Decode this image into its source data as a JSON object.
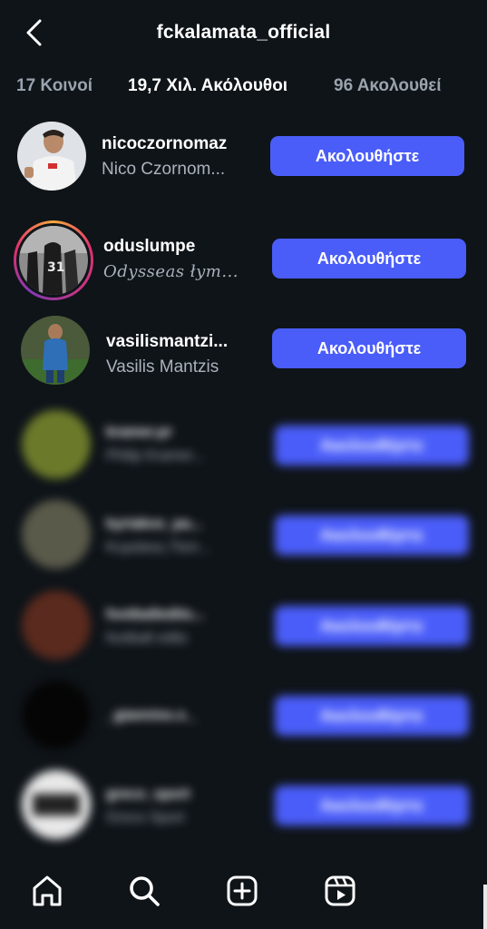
{
  "header": {
    "title": "fckalamata_official",
    "back_icon": "chevron-left-icon"
  },
  "tabs": [
    {
      "label": "17 Κοινοί",
      "active": false
    },
    {
      "label": "19,7 Χιλ. Ακόλουθοι",
      "active": true
    },
    {
      "label": "96 Ακολουθεί",
      "active": false
    }
  ],
  "follow_label": "Ακολουθήστε",
  "accounts": [
    {
      "username": "nicoczornomaz",
      "fullname": "Nico Czornom...",
      "story_ring": false,
      "avatar_color": "#dfe3e8",
      "blurred": false
    },
    {
      "username": "oduslumpe",
      "fullname": "Odysseas łym...",
      "story_ring": true,
      "avatar_color": "#6b6b6b",
      "blurred": false
    },
    {
      "username": "vasilismantzi...",
      "fullname": "Vasilis Mantzis",
      "story_ring": false,
      "avatar_color": "#3a6a9a",
      "blurred": false
    },
    {
      "username": "kramer.pr",
      "fullname": "Philip Kramer...",
      "story_ring": false,
      "avatar_color": "#6b7a2a",
      "blurred": true
    },
    {
      "username": "kyriakos_pa...",
      "fullname": "Κυριάκος Παπ...",
      "story_ring": false,
      "avatar_color": "#5a5a4a",
      "blurred": true
    },
    {
      "username": "footballedits...",
      "fullname": "football edits",
      "story_ring": false,
      "avatar_color": "#5a2a1e",
      "blurred": true
    },
    {
      "username": "_gianniss.x._",
      "fullname": "",
      "story_ring": false,
      "avatar_color": "#050505",
      "blurred": true
    },
    {
      "username": "greco_sport",
      "fullname": "Greco Sport",
      "story_ring": false,
      "avatar_color": "#e8e8e8",
      "blurred": true
    }
  ],
  "bottom_nav": [
    {
      "name": "home-icon"
    },
    {
      "name": "search-icon"
    },
    {
      "name": "create-icon"
    },
    {
      "name": "reels-icon"
    }
  ],
  "colors": {
    "background": "#0f1419",
    "button": "#4a5df9",
    "secondary_text": "#aab2bb"
  }
}
